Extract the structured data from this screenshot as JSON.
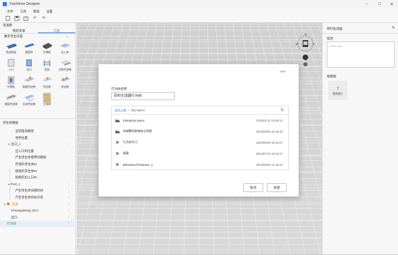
{
  "window": {
    "title": "FactVerse Designer"
  },
  "menu": [
    "文件",
    "工具",
    "帮助",
    "设置"
  ],
  "left_panel": {
    "title": "资源库",
    "tabs": [
      "我的资源",
      "工具"
    ],
    "active_tab": 1,
    "category": "数字孪生内容",
    "items": [
      "传送带段",
      "滚筒件",
      "升降机",
      "出入库",
      "入口",
      "出口",
      "货架",
      "分拣传送带",
      "升降机",
      "装载传送带",
      "传送带",
      "传送带",
      "装配传送带",
      "分流传送带",
      "立体库"
    ]
  },
  "tree": {
    "title": "孪生体模板",
    "rows": [
      {
        "label": "当前驱动路径",
        "indent": 2
      },
      {
        "label": "世界位置",
        "indent": 2
      },
      {
        "label": "出口_1",
        "indent": 1,
        "caret": "▾",
        "more": true
      },
      {
        "label": "出入口的位置",
        "indent": 2
      },
      {
        "label": "产生孪生体使用的模板",
        "indent": 2
      },
      {
        "label": "存放的孪生体ID",
        "indent": 2
      },
      {
        "label": "链接的孪生体ID",
        "indent": 2
      },
      {
        "label": "链接的出入口ID",
        "indent": 2
      },
      {
        "label": "Port_1",
        "indent": 1,
        "caret": "▾",
        "more": true
      },
      {
        "label": "产生孪生体间隔时间",
        "indent": 2,
        "more": true
      },
      {
        "label": "产生孪生体的标识符",
        "indent": 2,
        "more": true
      },
      {
        "label": "资源",
        "indent": 0,
        "caret": "▾",
        "more": true,
        "green": false,
        "accent": true
      },
      {
        "label": "ChuangJianQi_DLC",
        "indent": 1,
        "more": true
      },
      {
        "label": "出口",
        "indent": 1,
        "more": true
      },
      {
        "label": "行为树",
        "indent": 0,
        "green": true,
        "selected": true,
        "more": true
      }
    ]
  },
  "dialog": {
    "hint": "+MPT",
    "name_label": "行为树名称",
    "name_value": "原料生成器行为树",
    "breadcrumb_back": "返回上级",
    "breadcrumb_path": "/My Specs",
    "files": [
      {
        "name": "Enterprise specs",
        "date": "2024/01/11 16:58:14",
        "type": "folder"
      },
      {
        "name": "机械臂抓取物体示例套",
        "date": "2024/06/02 22:25:19",
        "type": "folder"
      },
      {
        "name": "行为树学习",
        "date": "2024/06/02 16:43:07",
        "type": "tree"
      },
      {
        "name": "看看",
        "date": "2024/07/10 16:23:17",
        "type": "tree"
      },
      {
        "name": "BehaviourTreeName_1",
        "date": "2024/06/04 14:45:22",
        "type": "tree"
      }
    ],
    "cancel_label": "取消",
    "ok_label": "新建"
  },
  "right_panel": {
    "title": "原料生成器",
    "desc_label": "描述",
    "desc_placeholder": "Enter text...",
    "map_label": "缩略图",
    "upload_label": "替换图片"
  },
  "colors": {
    "accent": "#2d7be0",
    "green": "#2aa24b",
    "warning": "#e08a00"
  }
}
